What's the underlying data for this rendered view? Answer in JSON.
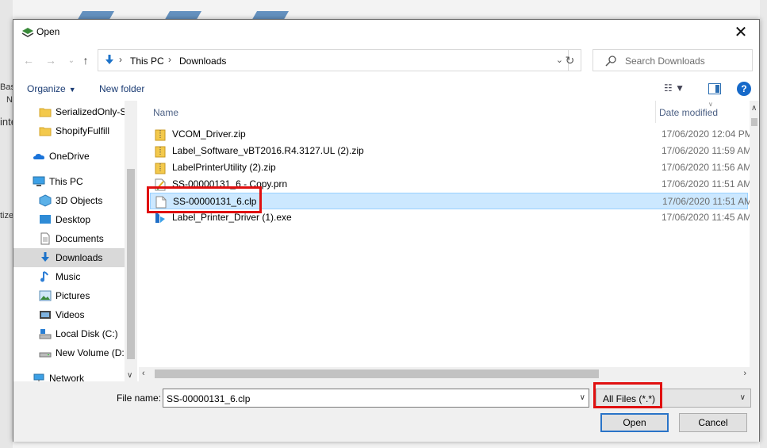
{
  "window": {
    "title": "Open",
    "close_glyph": "✕"
  },
  "address_bar": {
    "crumbs": [
      "This PC",
      "Downloads"
    ],
    "separator": "›",
    "back_glyph": "←",
    "forward_glyph": "→",
    "recent_glyph": "⌄",
    "up_glyph": "↑",
    "dropdown_glyph": "⌄",
    "refresh_glyph": "↻"
  },
  "search": {
    "placeholder": "Search Downloads"
  },
  "toolbar": {
    "organize_label": "Organize",
    "organize_caret": "▼",
    "new_folder_label": "New folder",
    "view_glyph": "☷ ▼",
    "help_glyph": "?"
  },
  "background": {
    "left_labels": [
      "Basi",
      "N",
      "inte",
      "tize"
    ]
  },
  "nav_pane": {
    "items": [
      {
        "label": "SerializedOnly-S",
        "icon": "folder-icon",
        "indent": 1
      },
      {
        "label": "ShopifyFulfill",
        "icon": "folder-icon",
        "indent": 1
      },
      {
        "label": "OneDrive",
        "icon": "onedrive-icon",
        "indent": 0
      },
      {
        "label": "This PC",
        "icon": "this-pc-icon",
        "indent": 0
      },
      {
        "label": "3D Objects",
        "icon": "3d-objects-icon",
        "indent": 1
      },
      {
        "label": "Desktop",
        "icon": "desktop-icon",
        "indent": 1
      },
      {
        "label": "Documents",
        "icon": "documents-icon",
        "indent": 1
      },
      {
        "label": "Downloads",
        "icon": "downloads-icon",
        "indent": 1,
        "selected": true
      },
      {
        "label": "Music",
        "icon": "music-icon",
        "indent": 1
      },
      {
        "label": "Pictures",
        "icon": "pictures-icon",
        "indent": 1
      },
      {
        "label": "Videos",
        "icon": "videos-icon",
        "indent": 1
      },
      {
        "label": "Local Disk (C:)",
        "icon": "local-disk-icon",
        "indent": 1
      },
      {
        "label": "New Volume (D:",
        "icon": "drive-icon",
        "indent": 1
      },
      {
        "label": "Network",
        "icon": "network-icon",
        "indent": 0
      }
    ]
  },
  "file_list": {
    "columns": {
      "name": "Name",
      "date": "Date modified"
    },
    "rows": [
      {
        "name": "VCOM_Driver.zip",
        "date": "17/06/2020 12:04 PM",
        "icon": "zip-folder-icon"
      },
      {
        "name": "Label_Software_vBT2016.R4.3127.UL (2).zip",
        "date": "17/06/2020 11:59 AM",
        "icon": "zip-folder-icon"
      },
      {
        "name": "LabelPrinterUtility (2).zip",
        "date": "17/06/2020 11:56 AM",
        "icon": "zip-folder-icon"
      },
      {
        "name": "SS-00000131_6 - Copy.prn",
        "date": "17/06/2020 11:51 AM",
        "icon": "prn-file-icon"
      },
      {
        "name": "SS-00000131_6.clp",
        "date": "17/06/2020 11:51 AM",
        "icon": "blank-file-icon",
        "selected": true
      },
      {
        "name": "Label_Printer_Driver (1).exe",
        "date": "17/06/2020 11:45 AM",
        "icon": "exe-file-icon"
      }
    ]
  },
  "bottom": {
    "file_name_label": "File name:",
    "file_name_value": "SS-00000131_6.clp",
    "file_type_value": "All Files (*.*)",
    "open_label": "Open",
    "cancel_label": "Cancel"
  },
  "colors": {
    "accent": "#2a74c8",
    "selection": "#cce8ff",
    "highlight": "#e01010"
  }
}
